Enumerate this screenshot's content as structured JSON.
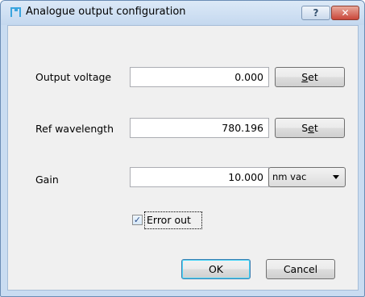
{
  "window": {
    "title": "Analogue output configuration",
    "help_label": "?",
    "close_label": "✕"
  },
  "form": {
    "output_voltage": {
      "label": "Output voltage",
      "value": "0.000",
      "set_prefix": "",
      "set_accel": "S",
      "set_suffix": "et"
    },
    "ref_wavelength": {
      "label": "Ref wavelength",
      "value": "780.196",
      "set_prefix": "S",
      "set_accel": "e",
      "set_suffix": "t"
    },
    "gain": {
      "label": "Gain",
      "value": "10.000",
      "unit_selected": "nm vac"
    },
    "error_out": {
      "label": "Error out",
      "checked": true,
      "check_glyph": "✓"
    }
  },
  "buttons": {
    "ok": "OK",
    "cancel": "Cancel"
  }
}
